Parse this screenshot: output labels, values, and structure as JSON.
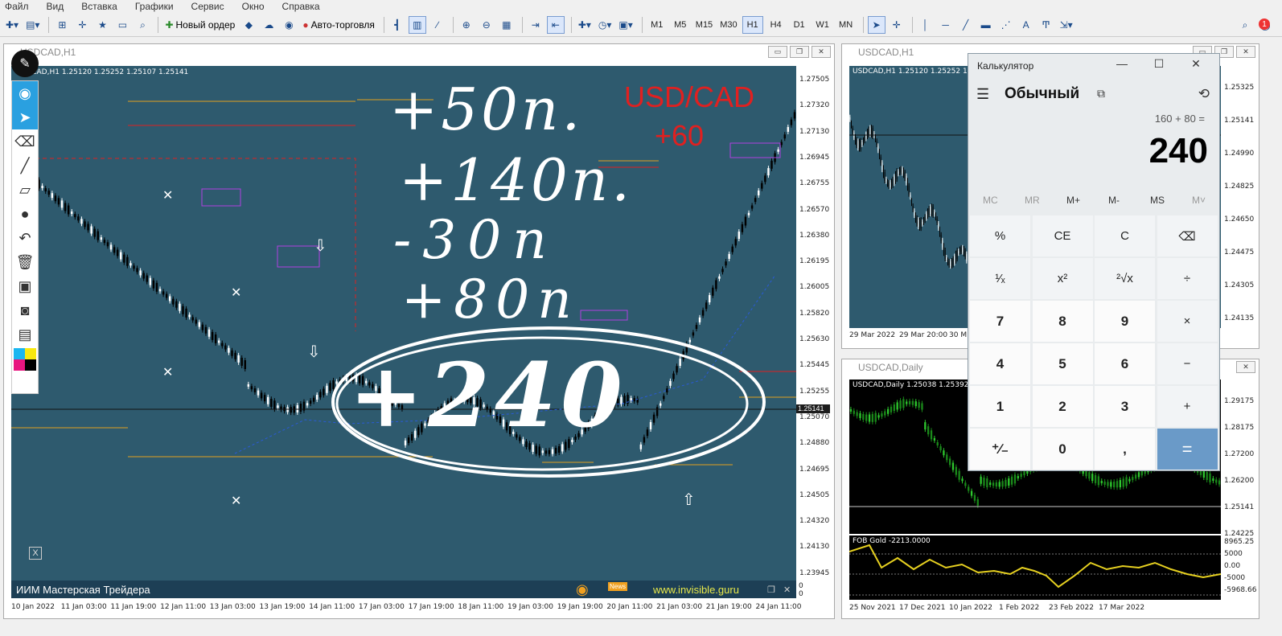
{
  "menu": [
    "Файл",
    "Вид",
    "Вставка",
    "Графики",
    "Сервис",
    "Окно",
    "Справка"
  ],
  "toolbar": {
    "new_order": "Новый ордер",
    "auto_trading": "Авто-торговля",
    "timeframes": [
      "M1",
      "M5",
      "M15",
      "M30",
      "H1",
      "H4",
      "D1",
      "W1",
      "MN"
    ],
    "selected_timeframe": "H1",
    "notifications": "1"
  },
  "chart_main": {
    "title": "USDCAD,H1",
    "info": "USDCAD,H1  1.25120 1.25252 1.25107 1.25141",
    "yticks": [
      "1.27505",
      "1.27320",
      "1.27130",
      "1.26945",
      "1.26755",
      "1.26570",
      "1.26380",
      "1.26195",
      "1.26005",
      "1.25820",
      "1.25630",
      "1.25445",
      "1.25255",
      "1.25070",
      "1.24880",
      "1.24695",
      "1.24505",
      "1.24320",
      "1.24130",
      "1.23945"
    ],
    "price_tag": "1.25141",
    "extra_yticks": [
      "0",
      "0"
    ],
    "xticks": [
      "10 Jan 2022",
      "11 Jan 03:00",
      "11 Jan 19:00",
      "12 Jan 11:00",
      "13 Jan 03:00",
      "13 Jan 19:00",
      "14 Jan 11:00",
      "17 Jan 03:00",
      "17 Jan 19:00",
      "18 Jan 11:00",
      "19 Jan 03:00",
      "19 Jan 19:00",
      "20 Jan 11:00",
      "21 Jan 03:00",
      "21 Jan 19:00",
      "24 Jan 11:00"
    ],
    "annotation_red": "USD/CAD",
    "annotation_red2": "+60",
    "bottom_bar": "ИИМ Мастерская Трейдера",
    "site": "www.invisible.guru",
    "news": "News",
    "close_x": "X"
  },
  "handwriting": [
    "+50п.",
    "+140п.",
    "-30п",
    "+80п",
    "+240"
  ],
  "chart_right_top": {
    "title": "USDCAD,H1",
    "info": "USDCAD,H1  1.25120 1.25252 1.25",
    "yticks": [
      "1.25325",
      "1.25141",
      "1.24990",
      "1.24825",
      "1.24650",
      "1.24475",
      "1.24305",
      "1.24135"
    ],
    "xticks": [
      "29 Mar 2022",
      "29 Mar 20:00",
      "30 M"
    ]
  },
  "chart_right_bottom": {
    "title": "USDCAD,Daily",
    "info": "USDCAD,Daily  1.25038 1.25392",
    "yticks": [
      "1.29175",
      "1.28175",
      "1.27200",
      "1.26200",
      "1.25141",
      "1.24225"
    ],
    "ind_label": "FOB Gold -2213.0000",
    "ind_yticks": [
      "8965.25",
      "5000",
      "0.00",
      "-5000",
      "-5968.66"
    ],
    "xticks": [
      "25 Nov 2021",
      "17 Dec 2021",
      "10 Jan 2022",
      "1 Feb 2022",
      "23 Feb 2022",
      "17 Mar 2022"
    ]
  },
  "calculator": {
    "title": "Калькулятор",
    "mode": "Обычный",
    "expression": "160 + 80 =",
    "display": "240",
    "memory": [
      "MC",
      "MR",
      "M+",
      "M-",
      "MS",
      "M˅"
    ],
    "keys": [
      "%",
      "CE",
      "C",
      "⌫",
      "¹⁄ₓ",
      "x²",
      "²√x",
      "÷",
      "7",
      "8",
      "9",
      "×",
      "4",
      "5",
      "6",
      "−",
      "1",
      "2",
      "3",
      "+",
      "⁺∕₋",
      "0",
      ",",
      "="
    ]
  },
  "colors": {
    "chart_bg": "#2e5a6e",
    "handwriting": "#ffffff",
    "red_annotation": "#e02020",
    "orange_line": "#e0a020",
    "calc_equals": "#6a9ac8"
  }
}
